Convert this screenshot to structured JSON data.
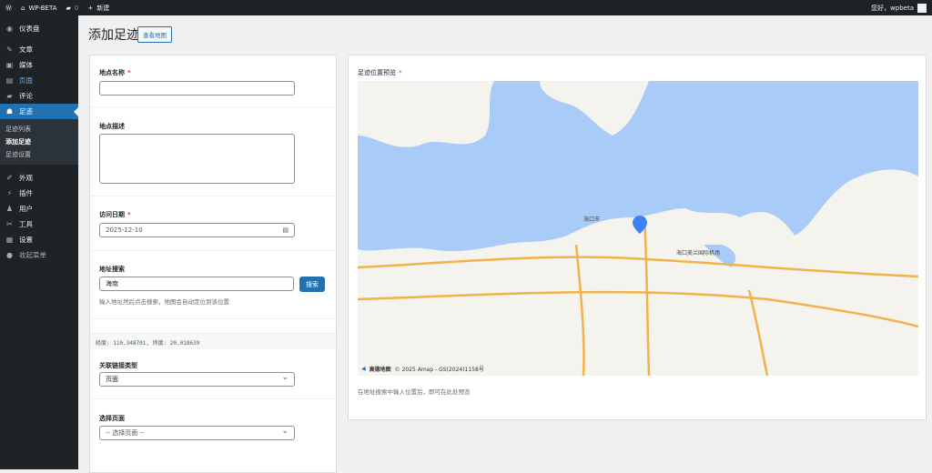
{
  "adminbar": {
    "site": "WP-BETA",
    "comments": "0",
    "new": "新建",
    "greeting": "您好，wpbeta"
  },
  "sidebar": {
    "items": [
      {
        "label": "仪表盘",
        "icon": "dashboard-icon"
      },
      {
        "label": "文章",
        "icon": "pin-icon"
      },
      {
        "label": "媒体",
        "icon": "media-icon"
      },
      {
        "label": "页面",
        "icon": "page-icon"
      },
      {
        "label": "评论",
        "icon": "comment-icon"
      },
      {
        "label": "足迹",
        "icon": "footprint-icon"
      }
    ],
    "submenu": [
      "足迹列表",
      "添加足迹",
      "足迹设置"
    ],
    "items2": [
      {
        "label": "外观",
        "icon": "brush-icon"
      },
      {
        "label": "插件",
        "icon": "plugin-icon"
      },
      {
        "label": "用户",
        "icon": "user-icon"
      },
      {
        "label": "工具",
        "icon": "wrench-icon"
      },
      {
        "label": "设置",
        "icon": "settings-icon"
      },
      {
        "label": "收起菜单",
        "icon": "collapse-icon"
      }
    ]
  },
  "page": {
    "title": "添加足迹",
    "view_map": "查看地图"
  },
  "form": {
    "name_label": "地点名称",
    "name_value": "",
    "desc_label": "地点描述",
    "date_label": "访问日期",
    "date_value": "2025-12-10",
    "search_label": "地址搜索",
    "search_value": "海南",
    "search_button": "搜索",
    "search_hint": "输入地址然后点击搜索，地图会自动定位到该位置",
    "coords": "经度: 110.348701, 纬度: 20.018639",
    "link_type_label": "关联链接类型",
    "link_type_value": "页面",
    "select_page_label": "选择页面",
    "select_page_value": "-- 选择页面 --",
    "required": "*"
  },
  "preview": {
    "label": "足迹位置预览",
    "hint": "在地址搜索中输入位置后，即可在此处预览",
    "map": {
      "city": "海口市",
      "airport": "海口美兰国际机场",
      "attribution_logo": "高德地图",
      "attribution": "© 2025 Amap - GS(2024)1158号",
      "sea_color": "#a9cbf7",
      "marker_color": "#3b82f6"
    }
  }
}
